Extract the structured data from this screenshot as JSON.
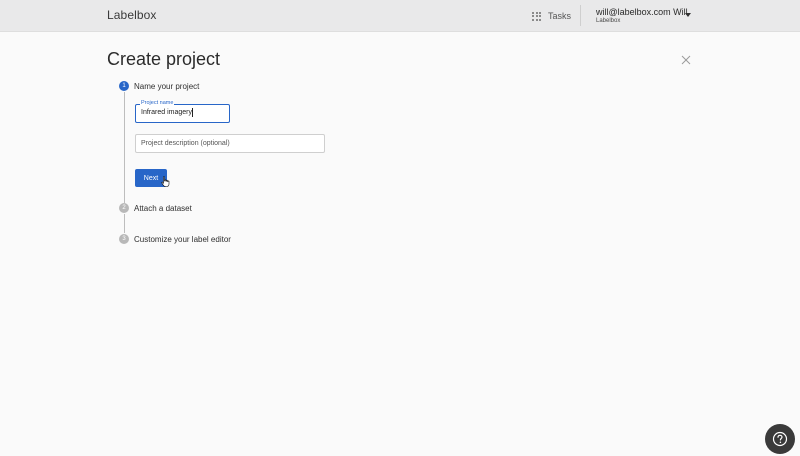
{
  "header": {
    "logo": "Labelbox",
    "tasks_label": "Tasks",
    "user_email": "will@labelbox.com Will",
    "user_org": "Labelbox",
    "icons": {
      "tasks": "grid-icon",
      "account_menu": "chevron-down-icon"
    }
  },
  "page": {
    "title": "Create project",
    "close_icon": "close-icon"
  },
  "steps": [
    {
      "number": "1",
      "title": "Name your project",
      "state": "active"
    },
    {
      "number": "2",
      "title": "Attach a dataset",
      "state": "inactive"
    },
    {
      "number": "3",
      "title": "Customize your label editor",
      "state": "inactive"
    }
  ],
  "form": {
    "project_name": {
      "label": "Project name",
      "value": "Infrared imagery"
    },
    "project_description": {
      "placeholder": "Project description (optional)",
      "value": ""
    },
    "next_label": "Next"
  },
  "help": {
    "icon": "help-icon"
  },
  "colors": {
    "accent": "#2866c8",
    "header_bg": "#e9e9ea",
    "page_bg": "#fafafa",
    "inactive_step": "#b8b8b8",
    "help_bg": "#3a3a3a"
  }
}
